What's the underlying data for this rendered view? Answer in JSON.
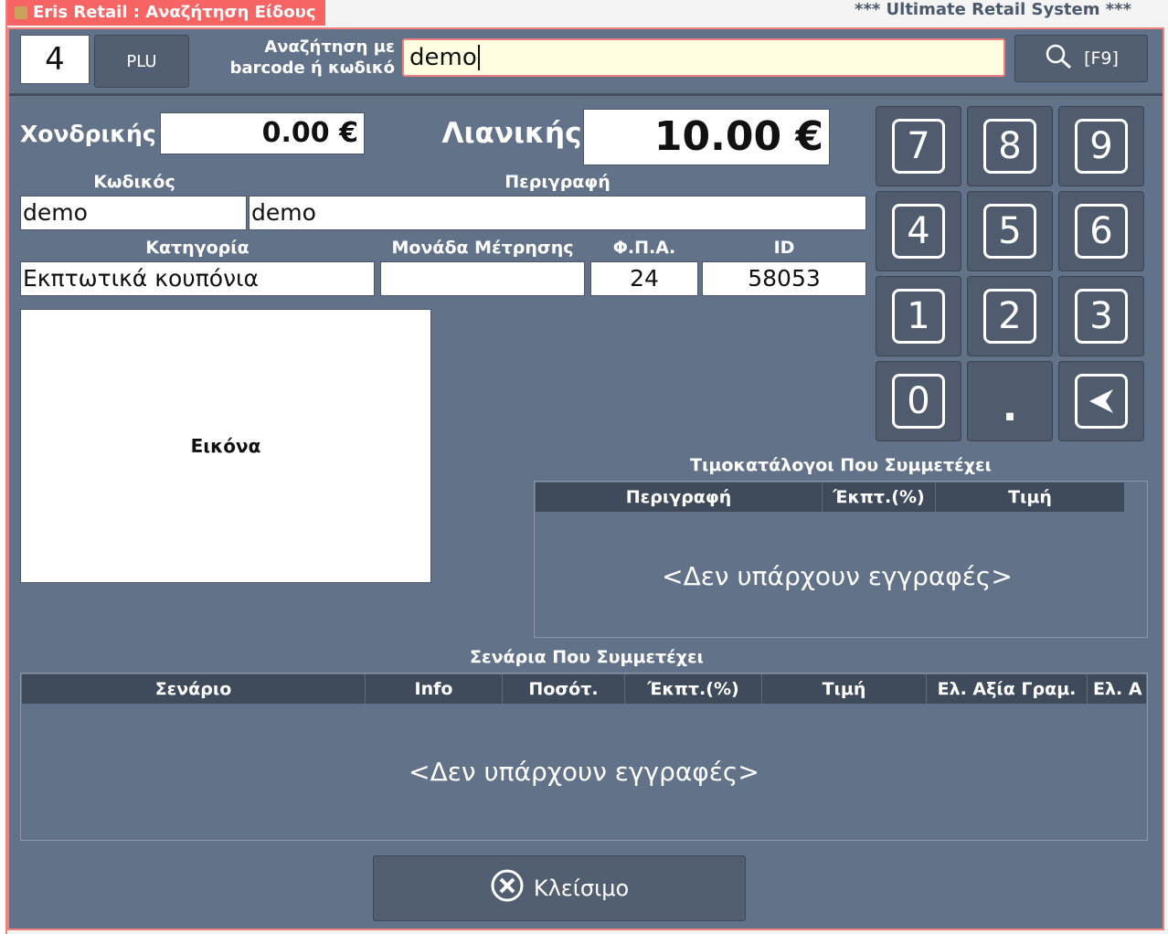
{
  "window": {
    "title": "Eris Retail : Αναζήτηση Είδους",
    "system_name": "*** Ultimate Retail System ***"
  },
  "search": {
    "quantity": "4",
    "plu_label": "PLU",
    "search_label_line1": "Αναζήτηση με",
    "search_label_line2": "barcode ή κωδικό",
    "value": "demo",
    "search_button_label": "[F9]"
  },
  "prices": {
    "wholesale_label": "Χονδρικής",
    "wholesale_value": "0.00 €",
    "retail_label": "Λιανικής",
    "retail_value": "10.00 €"
  },
  "item": {
    "code_label": "Κωδικός",
    "code_value": "demo",
    "description_label": "Περιγραφή",
    "description_value": "demo",
    "category_label": "Κατηγορία",
    "category_value": "Εκπτωτικά κουπόνια",
    "unit_label": "Μονάδα Μέτρησης",
    "unit_value": "",
    "vat_label": "Φ.Π.Α.",
    "vat_value": "24",
    "id_label": "ID",
    "id_value": "58053",
    "image_label": "Εικόνα"
  },
  "keypad": {
    "keys": [
      "7",
      "8",
      "9",
      "4",
      "5",
      "6",
      "1",
      "2",
      "3",
      "0",
      ".",
      "backspace"
    ]
  },
  "pricelists": {
    "title": "Τιμοκατάλογοι Που Συμμετέχει",
    "columns": [
      "Περιγραφή",
      "Έκπτ.(%)",
      "Τιμή"
    ],
    "empty_text": "<Δεν υπάρχουν εγγραφές>"
  },
  "scenarios": {
    "title": "Σενάρια Που Συμμετέχει",
    "columns": [
      "Σενάριο",
      "Info",
      "Ποσότ.",
      "Έκπτ.(%)",
      "Τιμή",
      "Ελ. Αξία Γραμ.",
      "Ελ. Α"
    ],
    "empty_text": "<Δεν υπάρχουν εγγραφές>"
  },
  "footer": {
    "close_label": "Κλείσιμο"
  },
  "colors": {
    "panel_bg": "#627389",
    "title_tab": "#f76464",
    "search_bg": "#fffde0"
  }
}
